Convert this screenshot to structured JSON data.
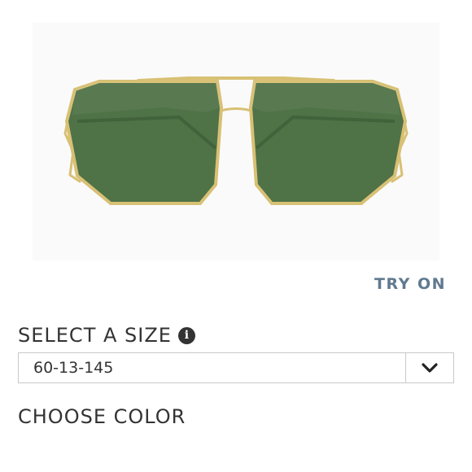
{
  "product": {
    "image_alt": "gold aviator sunglasses with green lenses",
    "frame_color": "#d8c074",
    "lens_color": "#4f7247"
  },
  "try_on": {
    "label": "TRY ON",
    "color": "#60798f"
  },
  "size": {
    "title": "SELECT A SIZE",
    "info_icon": "info-icon",
    "selected": "60-13-145",
    "dropdown_icon": "chevron-down-icon"
  },
  "color": {
    "title": "CHOOSE COLOR"
  }
}
